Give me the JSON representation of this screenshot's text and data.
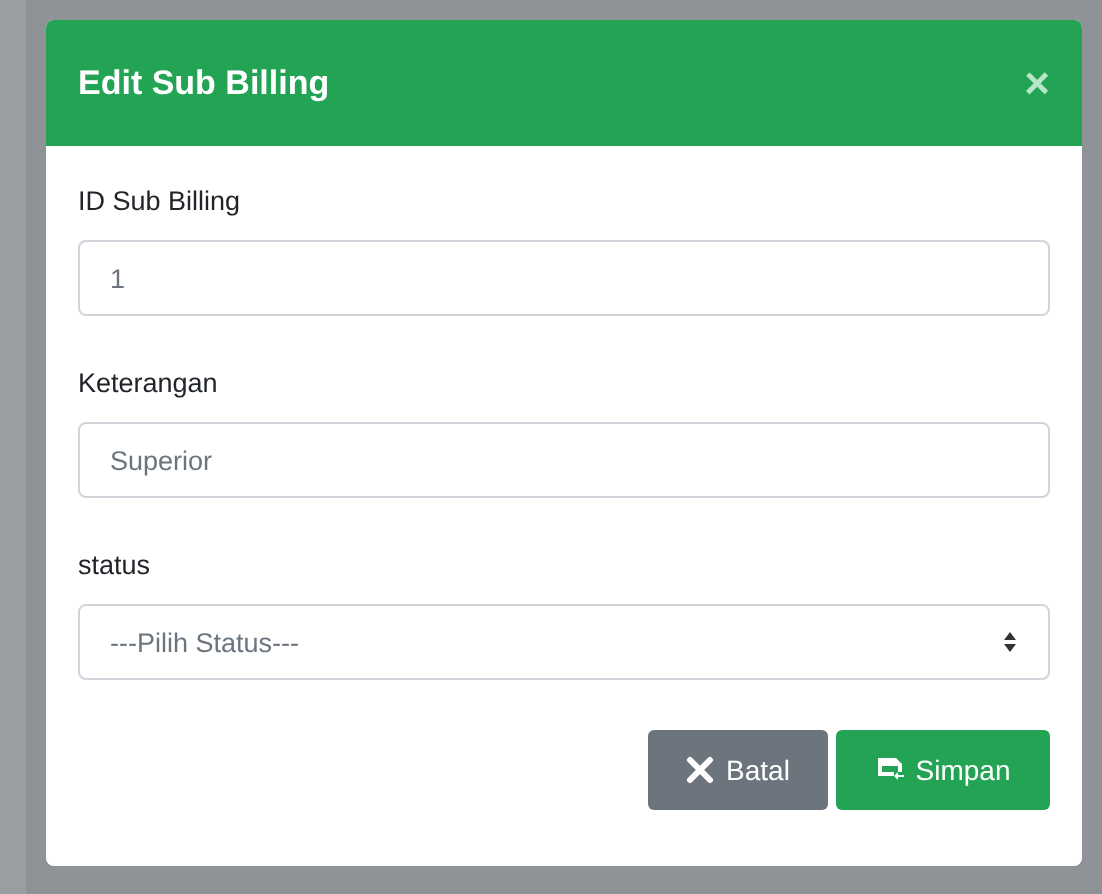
{
  "modal": {
    "title": "Edit Sub Billing",
    "close": "×"
  },
  "fields": [
    {
      "kind": "text",
      "label": "ID Sub Billing",
      "value": "1"
    },
    {
      "kind": "text",
      "label": "Keterangan",
      "value": "Superior"
    },
    {
      "kind": "select",
      "label": "status",
      "value": "---Pilih Status---"
    }
  ],
  "buttons": [
    {
      "kind": "cancel",
      "label": "Batal"
    },
    {
      "kind": "save",
      "label": "Simpan"
    }
  ]
}
